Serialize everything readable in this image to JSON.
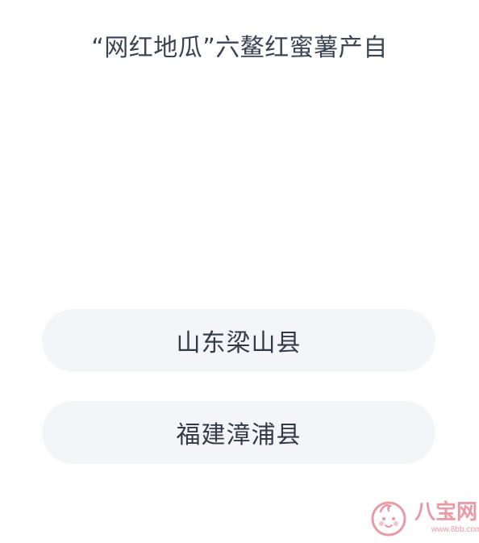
{
  "question": {
    "text": "“网红地瓜”六鳌红蜜薯产自"
  },
  "options": [
    {
      "label": "山东梁山县"
    },
    {
      "label": "福建漳浦县"
    }
  ],
  "watermark": {
    "icon": "baby-face-logo-icon",
    "title": "八宝网",
    "url": "www.8bb.com"
  },
  "colors": {
    "background": "#ffffff",
    "option_background": "#f3f5f8",
    "question_text": "#3b4453",
    "option_text": "#333a45",
    "watermark": "#e89aa6"
  }
}
